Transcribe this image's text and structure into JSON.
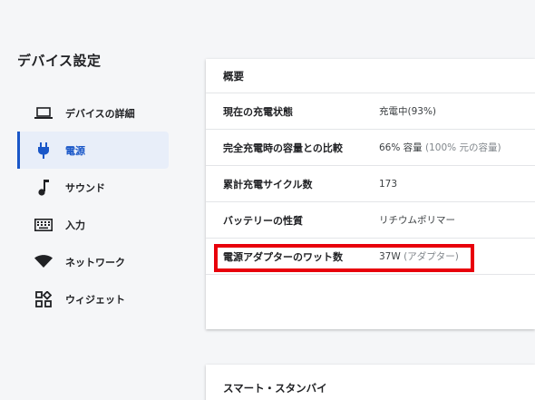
{
  "page_title": "デバイス設定",
  "sidebar": {
    "items": [
      {
        "label": "デバイスの詳細",
        "icon": "laptop-icon"
      },
      {
        "label": "電源",
        "icon": "power-plug-icon",
        "active": true
      },
      {
        "label": "サウンド",
        "icon": "music-note-icon"
      },
      {
        "label": "入力",
        "icon": "keyboard-icon"
      },
      {
        "label": "ネットワーク",
        "icon": "wifi-icon"
      },
      {
        "label": "ウィジェット",
        "icon": "widgets-icon"
      }
    ]
  },
  "summary": {
    "title": "概要",
    "rows": [
      {
        "key": "現在の充電状態",
        "value": "充電中(93%)",
        "sub": ""
      },
      {
        "key": "完全充電時の容量との比較",
        "value": "66% 容量",
        "sub": "(100% 元の容量)"
      },
      {
        "key": "累計充電サイクル数",
        "value": "173",
        "sub": ""
      },
      {
        "key": "バッテリーの性質",
        "value": "リチウムポリマー",
        "sub": ""
      },
      {
        "key": "電源アダプターのワット数",
        "value": "37W",
        "sub": "(アダプター)"
      }
    ]
  },
  "standby": {
    "title": "スマート・スタンバイ"
  },
  "colors": {
    "accent": "#1a57c8",
    "highlight": "#e8000b"
  }
}
